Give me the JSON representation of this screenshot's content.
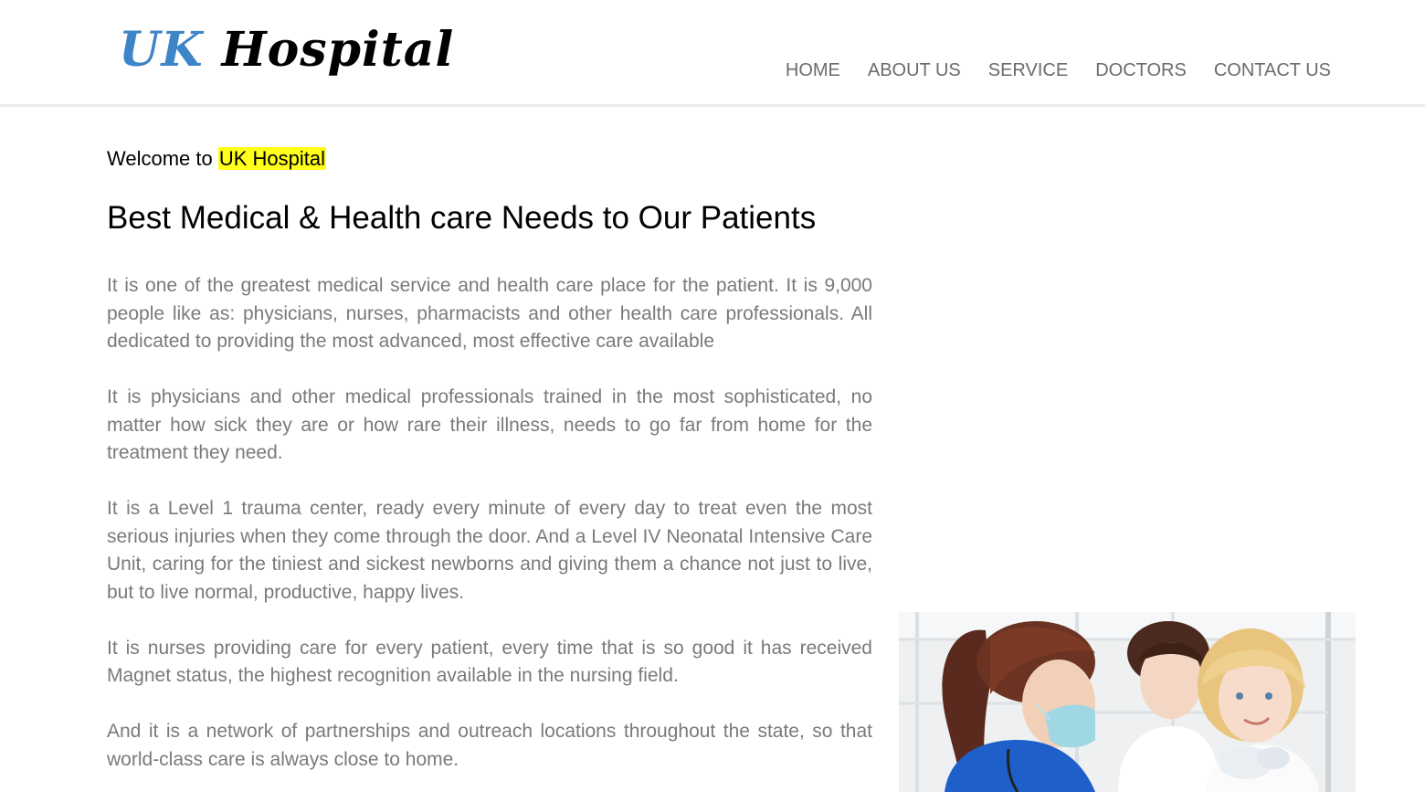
{
  "header": {
    "logo": {
      "part1": "UK",
      "part2": "Hospital",
      "part1_color": "#3d85c6",
      "part2_color": "#000000"
    },
    "nav": [
      {
        "label": "HOME"
      },
      {
        "label": "ABOUT US"
      },
      {
        "label": "SERVICE"
      },
      {
        "label": "DOCTORS"
      },
      {
        "label": "CONTACT US"
      }
    ]
  },
  "main": {
    "welcome_prefix": "Welcome to ",
    "welcome_highlight": "UK Hospital",
    "headline": "Best Medical & Health care Needs to Our Patients",
    "paragraphs": [
      "It is one of the greatest medical service and health care place for the patient. It is 9,000 people like as: physicians, nurses, pharmacists and other health care professionals. All dedicated to providing the most advanced, most effective care available",
      "It is physicians and other medical professionals trained in the most sophisticated, no matter how sick they are or how rare their illness, needs to go far from home for the treatment they need.",
      "It is a Level 1 trauma center, ready every minute of every day to treat even the most serious injuries when they come through the door. And a Level IV Neonatal Intensive Care Unit, caring for the tiniest and sickest newborns and giving them a chance not just to live, but to live normal, productive, happy lives.",
      "It is nurses providing care for every patient, every time that is so good it has received Magnet status, the highest recognition available in the nursing field.",
      "And it is a network of partnerships and outreach locations throughout the state, so that world-class care is always close to home."
    ]
  },
  "colors": {
    "highlight": "#ffff1a",
    "body_text": "#7a7a7a",
    "nav_text": "#6b6b6b"
  }
}
